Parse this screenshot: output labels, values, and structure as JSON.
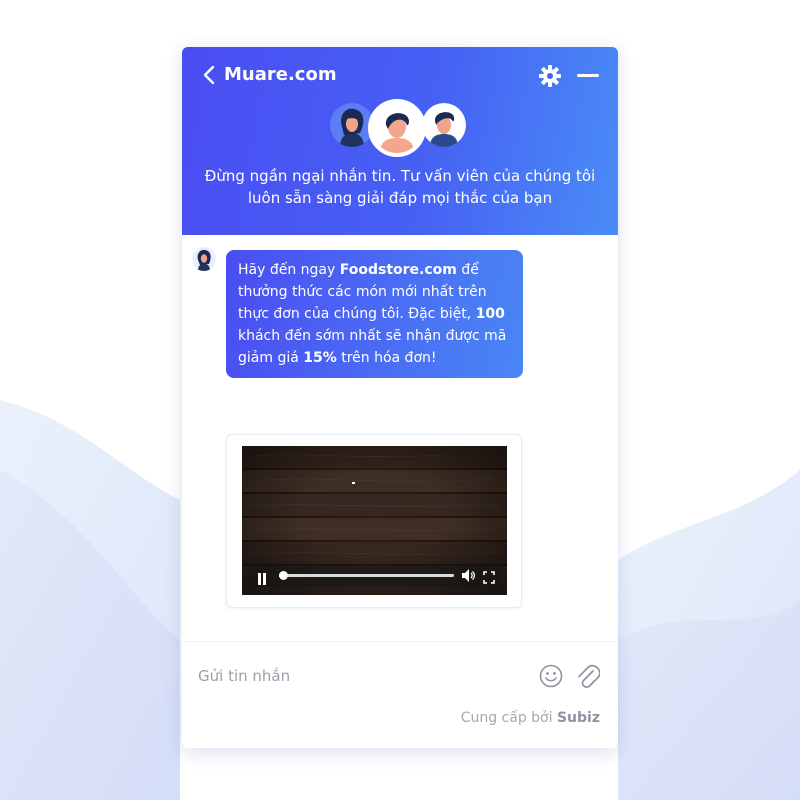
{
  "header": {
    "title": "Muare.com",
    "tagline": "Đừng ngần ngại nhắn tin. Tư vấn viên của chúng tôi luôn sẵn sàng giải đáp mọi thắc của bạn",
    "back_icon": "chevron-left-icon",
    "settings_icon": "gear-icon",
    "minimize_icon": "minimize-icon",
    "gradient_start": "#4a4df2",
    "gradient_end": "#4a8cf6"
  },
  "message": {
    "part1": "Hãy đến ngay ",
    "brand": "Foodstore.com",
    "part2": " để thưởng thức các món mới nhất trên thực đơn của chúng tôi. Đặc biệt, ",
    "count": "100",
    "part3": " khách đến sớm nhất sẽ nhận được mã giảm giá ",
    "discount": "15%",
    "part4": " trên hóa đơn!"
  },
  "video": {
    "progress": 0.02,
    "controls": [
      "pause-icon",
      "volume-icon",
      "fullscreen-icon"
    ]
  },
  "composer": {
    "placeholder": "Gửi tin nhắn",
    "powered_prefix": "Cung cấp bởi ",
    "powered_brand": "Subiz",
    "emoji_icon": "smiley-icon",
    "attach_icon": "paperclip-icon"
  }
}
